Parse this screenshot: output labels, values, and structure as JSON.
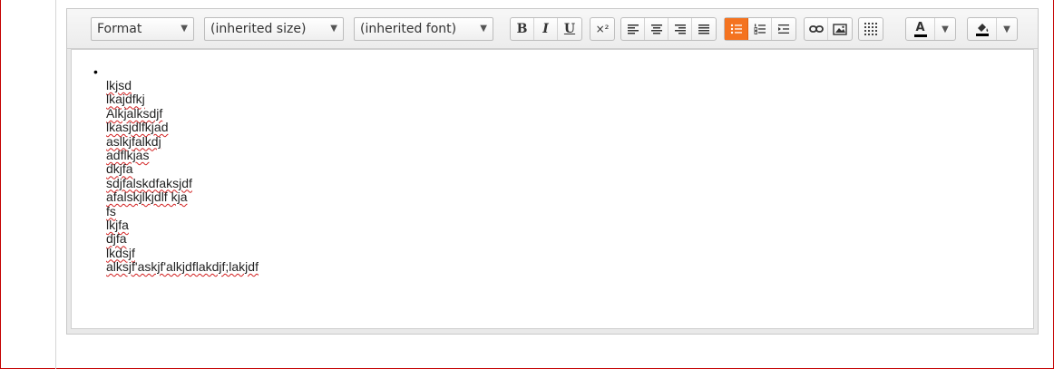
{
  "toolbar": {
    "format": "Format",
    "size": "(inherited size)",
    "font": "(inherited font)",
    "bold": "B",
    "italic": "I",
    "underline": "U",
    "superscript": "×²",
    "font_color_letter": "A",
    "icons": [
      "align-left-icon",
      "align-center-icon",
      "align-right-icon",
      "align-justify-icon",
      "bulleted-list-icon",
      "numbered-list-icon",
      "indent-icon",
      "link-icon",
      "image-icon",
      "table-icon",
      "font-color-icon",
      "background-color-icon"
    ],
    "active_color": "#f47320"
  },
  "editor": {
    "bullet": "•",
    "lines": [
      "lkjsd",
      "lkajdfkj",
      "Alkjalksdjf",
      "lkasjdlfkjad",
      "aslkjfalkdj",
      "adflkjas",
      "dkjfa",
      "sdjfalskdfaksjdf",
      "afalskjlkjdlf kja",
      "fs",
      "lkjfa",
      "djfa",
      "lkdsjf",
      "alksjf'askjf'alkjdflakdjf;lakjdf"
    ]
  }
}
